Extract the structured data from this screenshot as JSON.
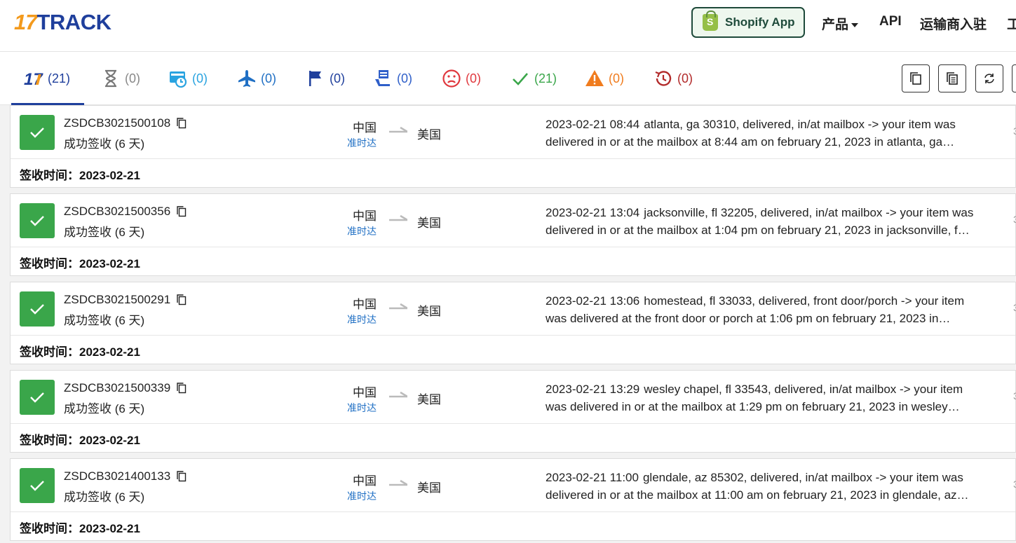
{
  "header": {
    "logo_num": "17",
    "logo_text": "TRACK",
    "shopify_label": "Shopify App",
    "nav": [
      {
        "label": "产品"
      },
      {
        "label": "API"
      },
      {
        "label": "运输商入驻"
      },
      {
        "label": "工"
      }
    ]
  },
  "tabs": [
    {
      "name": "all",
      "count": "(21)",
      "color": "#1f3f9c",
      "icon": "17-logo-icon"
    },
    {
      "name": "not-found",
      "count": "(0)",
      "color": "#888888",
      "icon": "hourglass-icon"
    },
    {
      "name": "info-received",
      "count": "(0)",
      "color": "#29a3e0",
      "icon": "truck-clock-icon"
    },
    {
      "name": "in-transit",
      "count": "(0)",
      "color": "#1f6fc4",
      "icon": "airplane-icon"
    },
    {
      "name": "pickup",
      "count": "(0)",
      "color": "#1f3f9c",
      "icon": "flag-icon"
    },
    {
      "name": "out-for-delivery",
      "count": "(0)",
      "color": "#2f5fc9",
      "icon": "delivery-person-icon"
    },
    {
      "name": "undelivered",
      "count": "(0)",
      "color": "#e0383e",
      "icon": "sad-face-icon"
    },
    {
      "name": "delivered",
      "count": "(21)",
      "color": "#3aa64a",
      "icon": "check-icon"
    },
    {
      "name": "alert",
      "count": "(0)",
      "color": "#f07c1e",
      "icon": "warning-icon"
    },
    {
      "name": "expired",
      "count": "(0)",
      "color": "#b22a2a",
      "icon": "history-icon"
    }
  ],
  "shipments": [
    {
      "tracking": "ZSDCB3021500108",
      "status": "成功签收 (6 天)",
      "origin": "中国",
      "ontime": "准时达",
      "dest": "美国",
      "event_time": "2023-02-21 08:44",
      "event_line1": "atlanta, ga 30310, delivered, in/at mailbox -> your item was",
      "event_line2": "delivered in or at the mailbox at 8:44 am on february 21, 2023 in atlanta, ga…",
      "signed_label": "签收时间：",
      "signed_date": "2023-02-21"
    },
    {
      "tracking": "ZSDCB3021500356",
      "status": "成功签收 (6 天)",
      "origin": "中国",
      "ontime": "准时达",
      "dest": "美国",
      "event_time": "2023-02-21 13:04",
      "event_line1": "jacksonville, fl 32205, delivered, in/at mailbox -> your item was",
      "event_line2": "delivered in or at the mailbox at 1:04 pm on february 21, 2023 in jacksonville, fl…",
      "signed_label": "签收时间：",
      "signed_date": "2023-02-21"
    },
    {
      "tracking": "ZSDCB3021500291",
      "status": "成功签收 (6 天)",
      "origin": "中国",
      "ontime": "准时达",
      "dest": "美国",
      "event_time": "2023-02-21 13:06",
      "event_line1": "homestead, fl 33033, delivered, front door/porch -> your item",
      "event_line2": "was delivered at the front door or porch at 1:06 pm on february 21, 2023 in…",
      "signed_label": "签收时间：",
      "signed_date": "2023-02-21"
    },
    {
      "tracking": "ZSDCB3021500339",
      "status": "成功签收 (6 天)",
      "origin": "中国",
      "ontime": "准时达",
      "dest": "美国",
      "event_time": "2023-02-21 13:29",
      "event_line1": "wesley chapel, fl 33543, delivered, in/at mailbox -> your item",
      "event_line2": "was delivered in or at the mailbox at 1:29 pm on february 21, 2023 in wesley…",
      "signed_label": "签收时间：",
      "signed_date": "2023-02-21"
    },
    {
      "tracking": "ZSDCB3021400133",
      "status": "成功签收 (6 天)",
      "origin": "中国",
      "ontime": "准时达",
      "dest": "美国",
      "event_time": "2023-02-21 11:00",
      "event_line1": "glendale, az 85302, delivered, in/at mailbox -> your item was",
      "event_line2": "delivered in or at the mailbox at 11:00 am on february 21, 2023 in glendale, az…",
      "signed_label": "签收时间：",
      "signed_date": "2023-02-21"
    }
  ],
  "edge_digit": "3"
}
